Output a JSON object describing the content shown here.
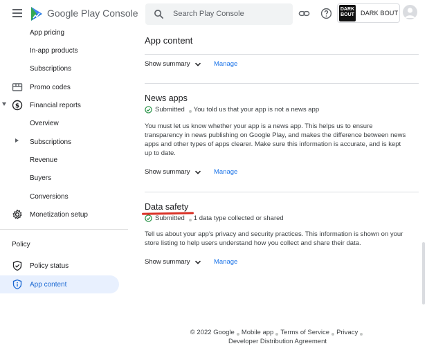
{
  "brand": {
    "name": "Google Play Console"
  },
  "search": {
    "placeholder": "Search Play Console"
  },
  "account": {
    "badge_line1": "DARK",
    "badge_line2": "BOUT",
    "name": "DARK BOUT"
  },
  "sidebar": {
    "items": [
      {
        "label": "App pricing"
      },
      {
        "label": "In-app products"
      },
      {
        "label": "Subscriptions"
      },
      {
        "label": "Promo codes"
      },
      {
        "label": "Financial reports"
      },
      {
        "label": "Overview"
      },
      {
        "label": "Subscriptions"
      },
      {
        "label": "Revenue"
      },
      {
        "label": "Buyers"
      },
      {
        "label": "Conversions"
      },
      {
        "label": "Monetization setup"
      }
    ],
    "policy_heading": "Policy",
    "policy_items": [
      {
        "label": "Policy status"
      },
      {
        "label": "App content"
      }
    ]
  },
  "main": {
    "page_title": "App content",
    "show_summary": "Show summary",
    "manage": "Manage",
    "news": {
      "title": "News apps",
      "status": "Submitted",
      "note": "You told us that your app is not a news app",
      "description": "You must let us know whether your app is a news app. This helps us to ensure transparency in news publishing on Google Play, and makes the difference between news apps and other types of apps clearer. Make sure this information is accurate, and is kept up to date."
    },
    "data_safety": {
      "title": "Data safety",
      "status": "Submitted",
      "note": "1 data type collected or shared",
      "description": "Tell us about your app's privacy and security practices. This information is shown on your store listing to help users understand how you collect and share their data."
    }
  },
  "footer": {
    "copyright": "© 2022 Google",
    "mobile_app": "Mobile app",
    "terms": "Terms of Service",
    "privacy": "Privacy",
    "dda": "Developer Distribution Agreement"
  },
  "colors": {
    "accent": "#1a73e8",
    "active_bg": "#e8f0fe",
    "success": "#1e8e3e",
    "annotation": "#d93025"
  }
}
